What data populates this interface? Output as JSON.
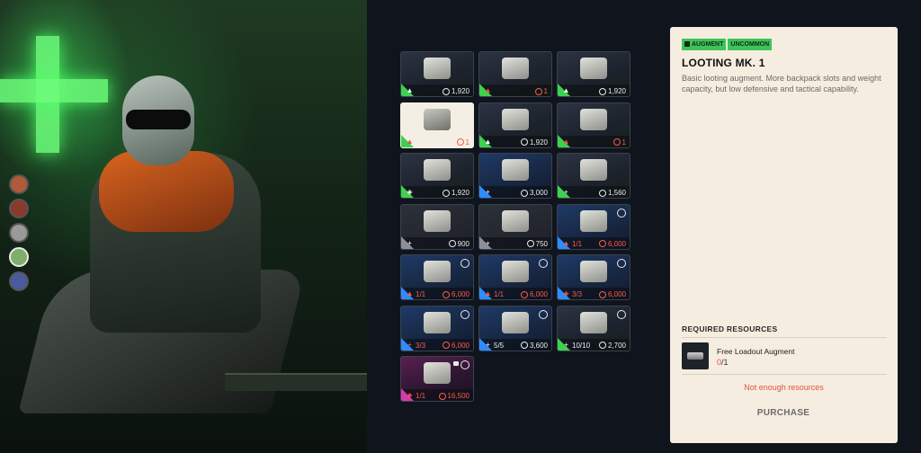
{
  "colors": {
    "uncommon": "#3ed14d",
    "rare": "#2f8cff",
    "epic": "#d23cae",
    "common": "#8a8f99",
    "warning": "#e0533d",
    "panel_bg": "#f5ede0"
  },
  "grid": {
    "items": [
      {
        "rarity": "green",
        "icon": "augment-icon",
        "qty": "",
        "price": "1,920",
        "price_red": false,
        "timer": false,
        "lock": false,
        "selected": false
      },
      {
        "rarity": "green",
        "icon": "augment-icon",
        "qty": "",
        "price": "1",
        "price_red": true,
        "timer": false,
        "lock": false,
        "selected": false
      },
      {
        "rarity": "green",
        "icon": "augment-icon",
        "qty": "",
        "price": "1,920",
        "price_red": false,
        "timer": false,
        "lock": false,
        "selected": false
      },
      {
        "rarity": "green",
        "icon": "augment-icon",
        "qty": "",
        "price": "1",
        "price_red": true,
        "timer": false,
        "lock": false,
        "selected": true
      },
      {
        "rarity": "green",
        "icon": "augment-icon",
        "qty": "",
        "price": "1,920",
        "price_red": false,
        "timer": false,
        "lock": false,
        "selected": false
      },
      {
        "rarity": "green",
        "icon": "augment-icon",
        "qty": "",
        "price": "1",
        "price_red": true,
        "timer": false,
        "lock": false,
        "selected": false
      },
      {
        "rarity": "green",
        "icon": "shield-icon",
        "qty": "",
        "price": "1,920",
        "price_red": false,
        "timer": false,
        "lock": false,
        "selected": false
      },
      {
        "rarity": "blue",
        "icon": "plus-icon",
        "qty": "",
        "price": "3,000",
        "price_red": false,
        "timer": false,
        "lock": false,
        "selected": false
      },
      {
        "rarity": "green",
        "icon": "plus-icon",
        "qty": "",
        "price": "1,560",
        "price_red": false,
        "timer": false,
        "lock": false,
        "selected": false
      },
      {
        "rarity": "gray",
        "icon": "plus-icon",
        "qty": "",
        "price": "900",
        "price_red": false,
        "timer": false,
        "lock": false,
        "selected": false
      },
      {
        "rarity": "gray",
        "icon": "plus-icon",
        "qty": "",
        "price": "750",
        "price_red": false,
        "timer": false,
        "lock": false,
        "selected": false
      },
      {
        "rarity": "blue",
        "icon": "augment-icon",
        "qty": "1/1",
        "price": "6,000",
        "price_red": true,
        "timer": true,
        "lock": false,
        "selected": false
      },
      {
        "rarity": "blue",
        "icon": "augment-icon",
        "qty": "1/1",
        "price": "6,000",
        "price_red": true,
        "timer": true,
        "lock": false,
        "selected": false
      },
      {
        "rarity": "blue",
        "icon": "augment-icon",
        "qty": "1/1",
        "price": "6,000",
        "price_red": true,
        "timer": true,
        "lock": false,
        "selected": false
      },
      {
        "rarity": "blue",
        "icon": "shield-icon",
        "qty": "3/3",
        "price": "6,000",
        "price_red": true,
        "timer": true,
        "lock": false,
        "selected": false
      },
      {
        "rarity": "blue",
        "icon": "plus-icon",
        "qty": "3/3",
        "price": "6,000",
        "price_red": true,
        "timer": true,
        "lock": false,
        "selected": false
      },
      {
        "rarity": "blue",
        "icon": "plus-icon",
        "qty": "5/5",
        "price": "3,600",
        "price_red": false,
        "timer": true,
        "lock": false,
        "selected": false
      },
      {
        "rarity": "green",
        "icon": "plus-icon",
        "qty": "10/10",
        "price": "2,700",
        "price_red": false,
        "timer": true,
        "lock": false,
        "selected": false
      },
      {
        "rarity": "pink",
        "icon": "shield-icon",
        "qty": "1/1",
        "price": "16,500",
        "price_red": true,
        "timer": true,
        "lock": true,
        "selected": false
      }
    ]
  },
  "detail": {
    "tag_type": "AUGMENT",
    "tag_rarity": "UNCOMMON",
    "title": "LOOTING MK. 1",
    "description": "Basic looting augment. More backpack slots and weight capacity, but low defensive and tactical capability.",
    "required_header": "REQUIRED RESOURCES",
    "resource_name": "Free Loadout Augment",
    "resource_have": "0",
    "resource_need": "/1",
    "warning": "Not enough resources",
    "purchase_label": "PURCHASE"
  },
  "portraits": [
    {
      "color": "#b05a3a",
      "selected": false
    },
    {
      "color": "#8a3a2a",
      "selected": false
    },
    {
      "color": "#9a9a9a",
      "selected": false
    },
    {
      "color": "#7fae6a",
      "selected": true
    },
    {
      "color": "#4a5aa0",
      "selected": false
    }
  ]
}
